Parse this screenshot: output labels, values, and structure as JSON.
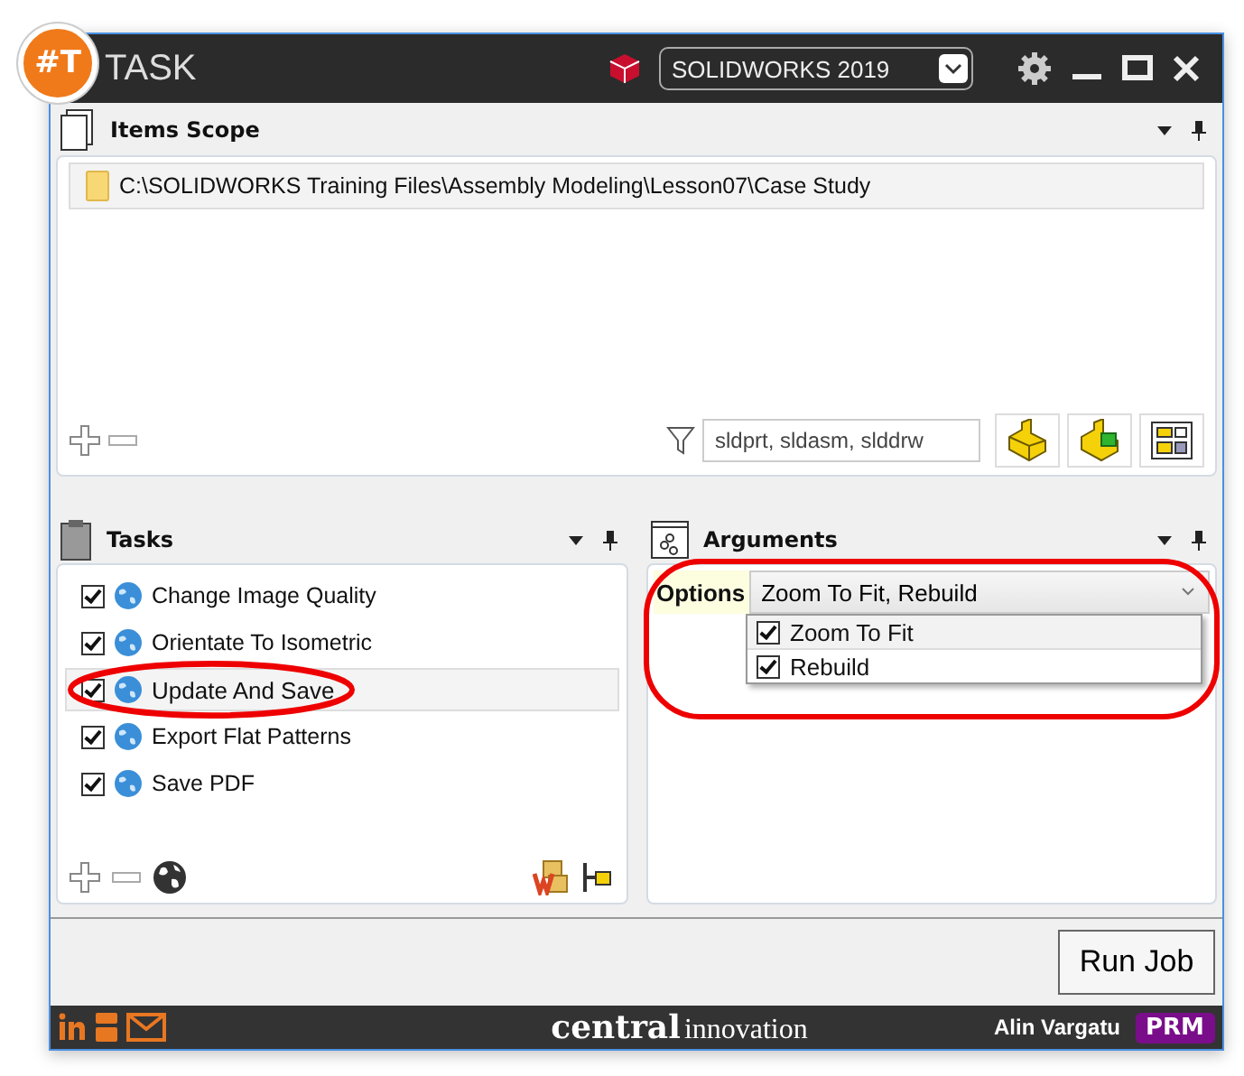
{
  "app": {
    "logo": "#T",
    "title": "TASK",
    "version": "SOLIDWORKS 2019"
  },
  "items_scope": {
    "title": "Items Scope",
    "items": [
      {
        "path": "C:\\SOLIDWORKS Training Files\\Assembly Modeling\\Lesson07\\Case Study"
      }
    ],
    "filter": "sldprt, sldasm, slddrw"
  },
  "tasks": {
    "title": "Tasks",
    "items": [
      {
        "label": "Change Image Quality",
        "checked": true,
        "selected": false,
        "highlighted": false
      },
      {
        "label": "Orientate To Isometric",
        "checked": true,
        "selected": false,
        "highlighted": false
      },
      {
        "label": "Update And Save",
        "checked": true,
        "selected": true,
        "highlighted": true
      },
      {
        "label": "Export Flat Patterns",
        "checked": true,
        "selected": false,
        "highlighted": false
      },
      {
        "label": "Save PDF",
        "checked": true,
        "selected": false,
        "highlighted": false
      }
    ]
  },
  "arguments": {
    "title": "Arguments",
    "highlighted": true,
    "label": "Options",
    "value": "Zoom To Fit, Rebuild",
    "options": [
      {
        "label": "Zoom To Fit",
        "checked": true,
        "selected": true
      },
      {
        "label": "Rebuild",
        "checked": true,
        "selected": false
      }
    ]
  },
  "run_button": "Run Job",
  "footer": {
    "brand": "central",
    "brand_suffix": "innovation",
    "user": "Alin Vargatu",
    "badge": "PRM"
  }
}
